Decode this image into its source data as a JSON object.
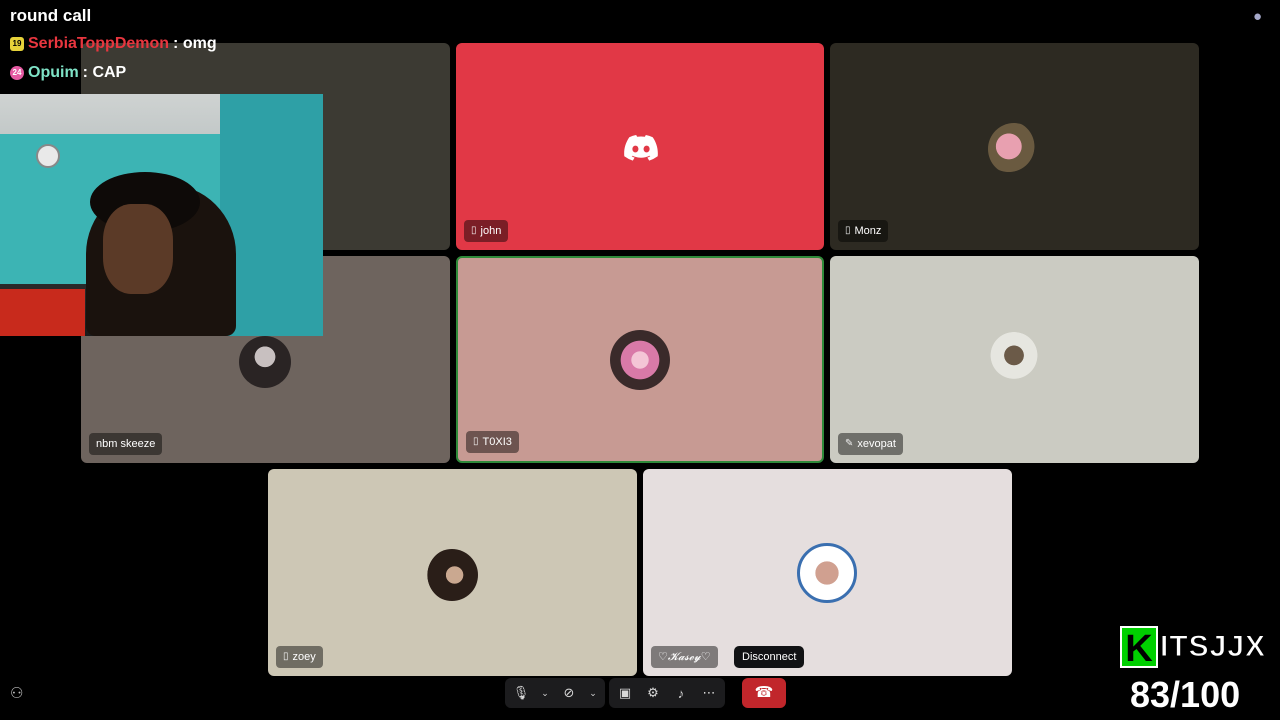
{
  "stream": {
    "title": "round call",
    "chat": [
      {
        "badge": "19",
        "user": "SerbiaToppDemon",
        "user_color": "#e8363f",
        "message": ": omg"
      },
      {
        "badge": "24",
        "user": "Opuim",
        "user_color": "#7fe3c7",
        "message": ": CAP"
      }
    ],
    "brand": {
      "k": "K",
      "name": "ITSJJX"
    },
    "score": "83/100"
  },
  "participants": [
    {
      "name": "john",
      "icon": "phone-icon",
      "color": "#e13846"
    },
    {
      "name": "Monz",
      "icon": "phone-icon",
      "color": "#2d2a22"
    },
    {
      "name": "nbm skeeze",
      "icon": "",
      "color": "#6e645e"
    },
    {
      "name": "T0XI3",
      "icon": "phone-icon",
      "color": "#c79a93",
      "speaking": true
    },
    {
      "name": "xevopat",
      "icon": "mic-muted-icon",
      "color": "#cbcbc2"
    },
    {
      "name": "zoey",
      "icon": "phone-icon",
      "color": "#cdc7b5"
    },
    {
      "name": "♡𝓚𝓪𝓼𝓮𝔂♡",
      "icon": "",
      "color": "#e5dede"
    }
  ],
  "controls": {
    "items": [
      "microphone-icon",
      "chevron-down-icon",
      "camera-off-icon",
      "chevron-down-icon",
      "screen-share-icon",
      "activities-icon",
      "soundboard-icon",
      "more-icon"
    ],
    "disconnect_tooltip": "Disconnect"
  }
}
